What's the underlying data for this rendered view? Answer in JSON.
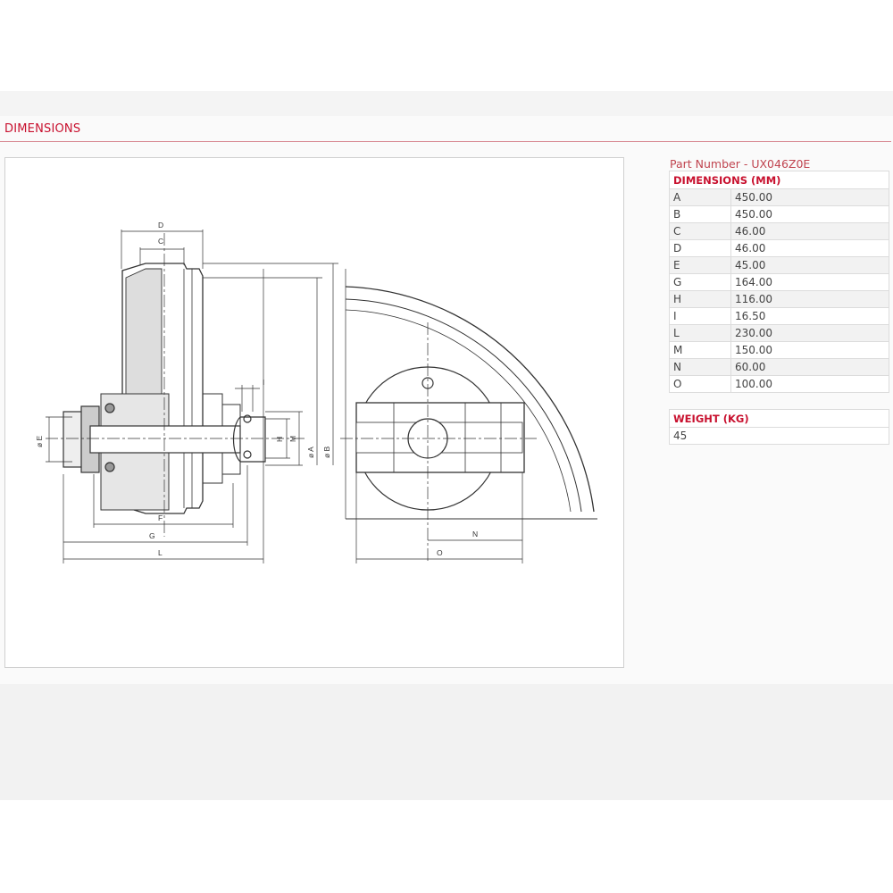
{
  "section": {
    "title": "DIMENSIONS"
  },
  "part": {
    "label": "Part Number - UX046Z0E"
  },
  "dimensions_table": {
    "header": "DIMENSIONS (MM)",
    "rows": [
      {
        "key": "A",
        "value": "450.00"
      },
      {
        "key": "B",
        "value": "450.00"
      },
      {
        "key": "C",
        "value": "46.00"
      },
      {
        "key": "D",
        "value": "46.00"
      },
      {
        "key": "E",
        "value": "45.00"
      },
      {
        "key": "G",
        "value": "164.00"
      },
      {
        "key": "H",
        "value": "116.00"
      },
      {
        "key": "I",
        "value": "16.50"
      },
      {
        "key": "L",
        "value": "230.00"
      },
      {
        "key": "M",
        "value": "150.00"
      },
      {
        "key": "N",
        "value": "60.00"
      },
      {
        "key": "O",
        "value": "100.00"
      }
    ]
  },
  "weight_table": {
    "header": "WEIGHT (KG)",
    "value": "45"
  },
  "drawing_labels": {
    "D": "D",
    "C": "C",
    "I": "I",
    "E": "ø E",
    "H": "H",
    "M": "M",
    "A": "ø A",
    "B": "ø B",
    "F": "F",
    "G": "G",
    "L": "L",
    "N": "N",
    "O": "O"
  },
  "colors": {
    "accent": "#c8102e",
    "line": "#333333"
  }
}
